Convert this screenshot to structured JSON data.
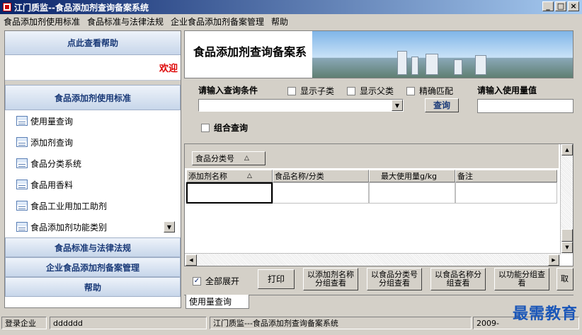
{
  "window": {
    "title": "江门质监--食品添加剂查询备案系统"
  },
  "menu": [
    "食品添加剂使用标准",
    "食品标准与法律法规",
    "企业食品添加剂备案管理",
    "帮助"
  ],
  "sidebar": {
    "help_header": "点此查看帮助",
    "welcome": "欢迎",
    "group1": "食品添加剂使用标准",
    "items": [
      "使用量查询",
      "添加剂查询",
      "食品分类系统",
      "食品用香料",
      "食品工业用加工助剂",
      "食品添加剂功能类别"
    ],
    "group2": "食品标准与法律法规",
    "group3": "企业食品添加剂备案管理",
    "group4": "帮助"
  },
  "main": {
    "banner_title": "食品添加剂查询备案系",
    "query_label": "请输入查询条件",
    "show_children": "显示子类",
    "show_parent": "显示父类",
    "exact_match": "精确匹配",
    "usage_value_label": "请输入使用量值",
    "query_button": "查询",
    "combined_query": "组合查询",
    "group_tag": "食品分类号",
    "columns": [
      "添加剂名称",
      "食品名称/分类",
      "最大使用量g/kg",
      "备注"
    ],
    "expand_all": "全部展开",
    "print": "打印",
    "btn_by_additive": "以添加剂名称分组查看",
    "btn_by_category": "以食品分类号分组查看",
    "btn_by_foodname": "以食品名称分组查看",
    "btn_by_function": "以功能分组查看",
    "btn_cut": "取",
    "tab": "使用量查询"
  },
  "status": {
    "login_label": "登录企业",
    "login_value": "dddddd",
    "app": "江门质监---食品添加剂查询备案系统",
    "date": "2009-"
  },
  "watermark": "最需教育"
}
